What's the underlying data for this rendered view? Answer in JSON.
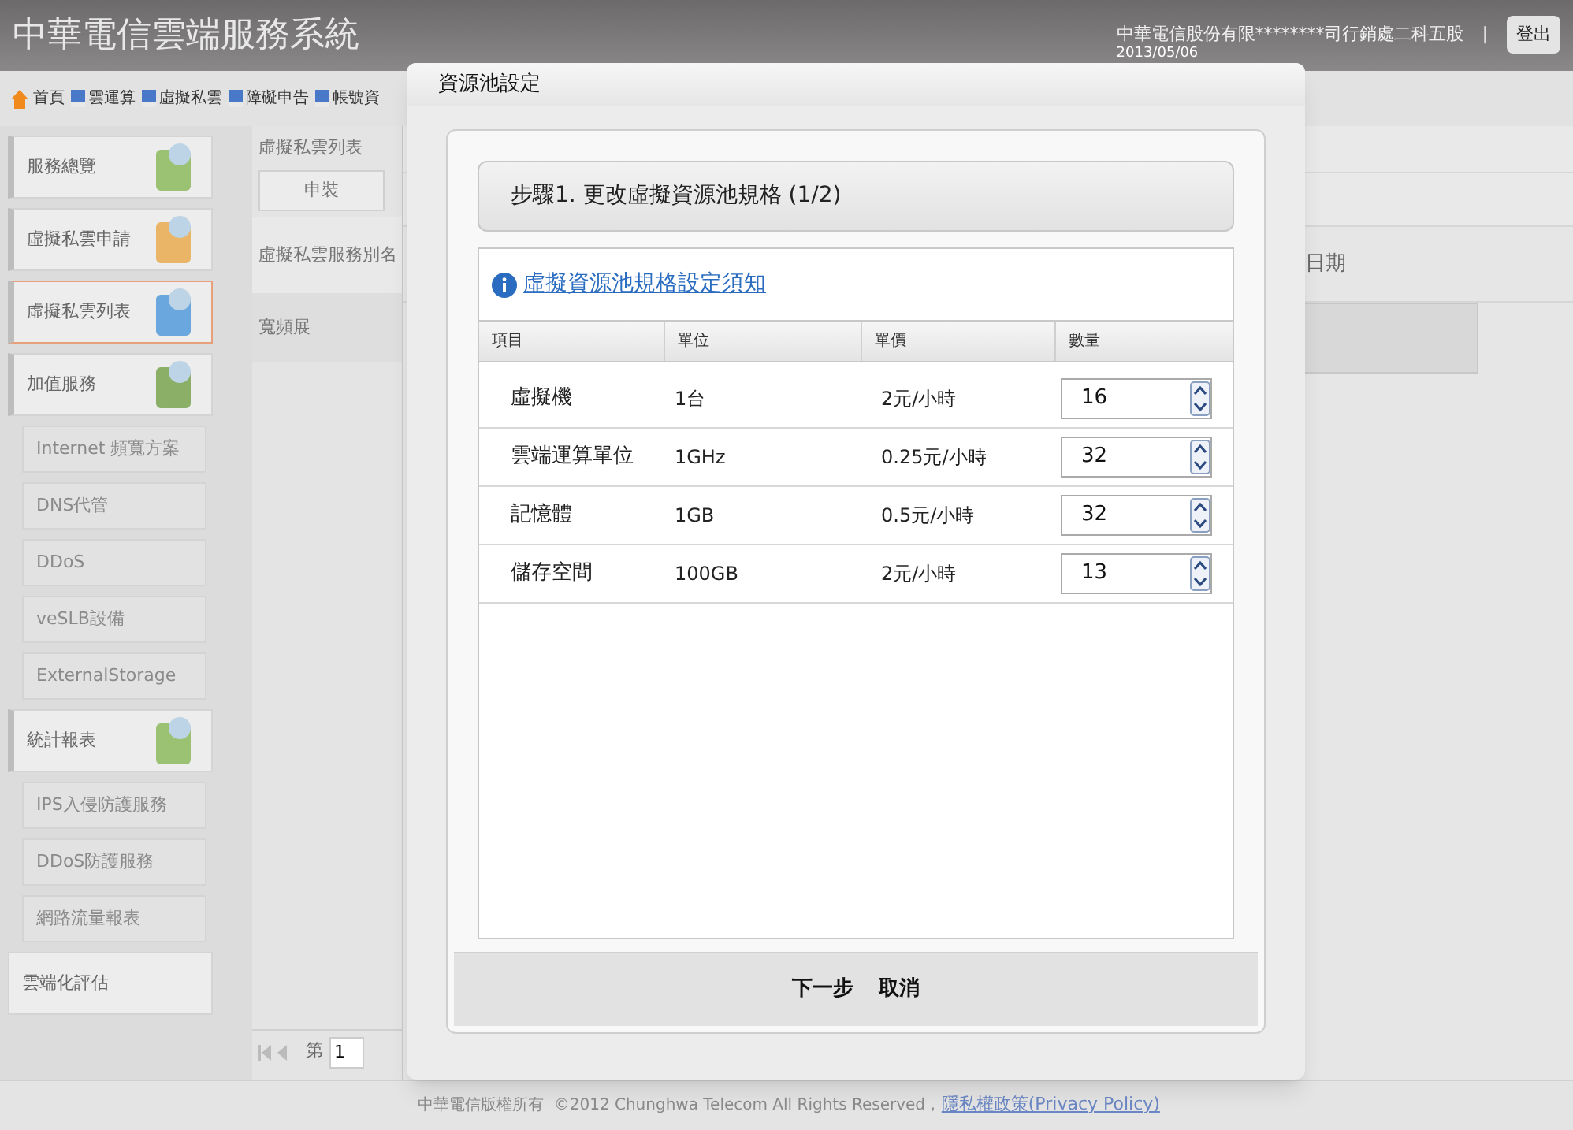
{
  "header": {
    "title": "中華電信雲端服務系統",
    "company": "中華電信股份有限********司行銷處二科五股",
    "date": "2013/05/06",
    "separator": "|",
    "logout": "登出"
  },
  "nav": [
    {
      "label": "首頁",
      "kind": "home"
    },
    {
      "label": "雲運算",
      "kind": "page"
    },
    {
      "label": "虛擬私雲",
      "kind": "page"
    },
    {
      "label": "障礙申告",
      "kind": "page"
    },
    {
      "label": "帳號資",
      "kind": "page"
    }
  ],
  "sidebar": {
    "items": [
      {
        "label": "服務總覽",
        "kind": "main",
        "selected": false
      },
      {
        "label": "虛擬私雲申請",
        "kind": "main",
        "selected": false
      },
      {
        "label": "虛擬私雲列表",
        "kind": "main",
        "selected": true
      },
      {
        "label": "加值服務",
        "kind": "main",
        "selected": false
      },
      {
        "label": "Internet 頻寬方案",
        "kind": "sub",
        "selected": false
      },
      {
        "label": "DNS代管",
        "kind": "sub",
        "selected": false
      },
      {
        "label": "DDoS",
        "kind": "sub",
        "selected": false
      },
      {
        "label": "veSLB設備",
        "kind": "sub",
        "selected": false
      },
      {
        "label": "ExternalStorage",
        "kind": "sub",
        "selected": false
      },
      {
        "label": "統計報表",
        "kind": "main",
        "selected": false
      },
      {
        "label": "IPS入侵防護服務",
        "kind": "sub",
        "selected": false
      },
      {
        "label": "DDoS防護服務",
        "kind": "sub",
        "selected": false
      },
      {
        "label": "網路流量報表",
        "kind": "sub",
        "selected": false
      },
      {
        "label": "雲端化評估",
        "kind": "plain",
        "selected": false
      }
    ]
  },
  "list_panel": {
    "title": "虛擬私雲列表",
    "button": "申裝",
    "column": "虛擬私雲服務別名",
    "rows": [
      "寬頻展"
    ],
    "pager": {
      "label": "第",
      "page": "1"
    }
  },
  "right_panel": {
    "column": "日期"
  },
  "dialog": {
    "title": "資源池設定",
    "step": "步驟1. 更改虛擬資源池規格 (1/2)",
    "notice_link": "虛擬資源池規格設定須知",
    "columns": [
      "項目",
      "單位",
      "單價",
      "數量"
    ],
    "rows": [
      {
        "item": "虛擬機",
        "unit": "1台",
        "price": "2元/小時",
        "quantity": "16"
      },
      {
        "item": "雲端運算單位",
        "unit": "1GHz",
        "price": "0.25元/小時",
        "quantity": "32"
      },
      {
        "item": "記憶體",
        "unit": "1GB",
        "price": "0.5元/小時",
        "quantity": "32"
      },
      {
        "item": "儲存空間",
        "unit": "100GB",
        "price": "2元/小時",
        "quantity": "13"
      }
    ],
    "buttons": [
      "下一步",
      "取消"
    ]
  },
  "footer": {
    "copyright": "中華電信版權所有  ©2012 Chunghwa Telecom All Rights Reserved ,",
    "privacy_link": "隱私權政策(Privacy Policy)"
  }
}
